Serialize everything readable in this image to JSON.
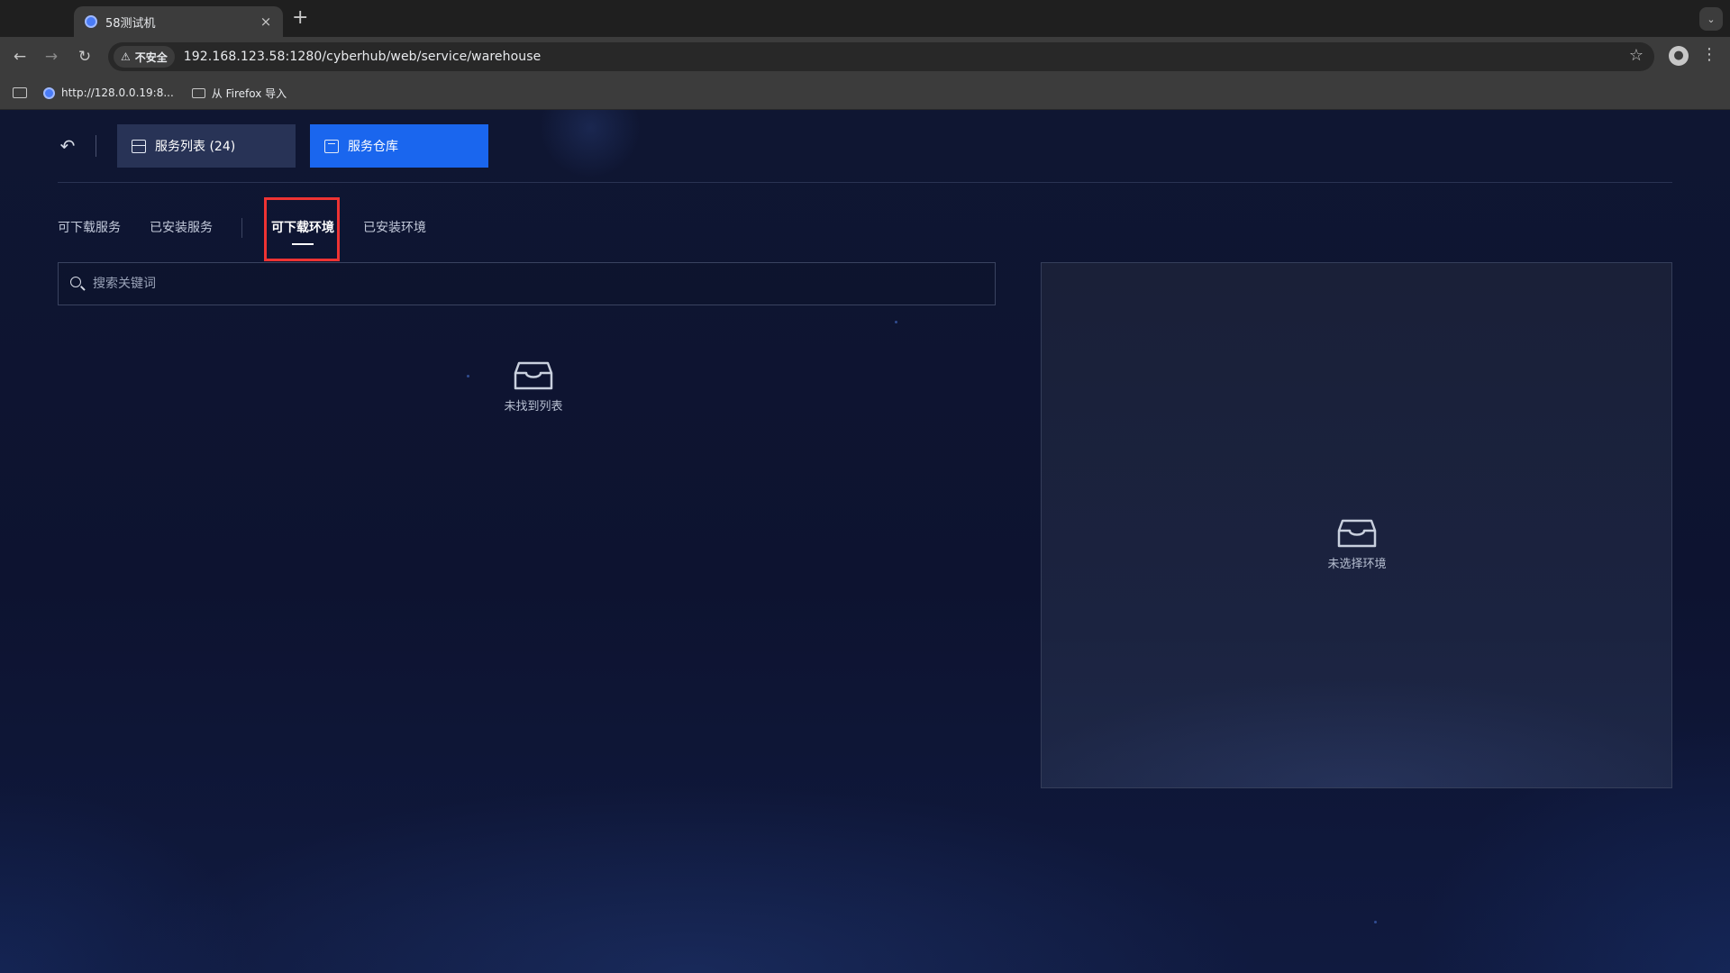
{
  "browser": {
    "tab_title": "58测试机",
    "tab_close": "×",
    "new_tab": "+",
    "security_label": "不安全",
    "url": "192.168.123.58:1280/cyberhub/web/service/warehouse",
    "bookmarks": [
      {
        "label": "http://128.0.0.19:8..."
      },
      {
        "label": "从 Firefox 导入"
      }
    ]
  },
  "app": {
    "top_buttons": {
      "service_list": "服务列表 (24)",
      "warehouse": "服务仓库"
    },
    "subtabs": [
      {
        "label": "可下载服务",
        "active": false
      },
      {
        "label": "已安装服务",
        "active": false
      },
      {
        "label": "可下载环境",
        "active": true
      },
      {
        "label": "已安装环境",
        "active": false
      }
    ],
    "search": {
      "placeholder": "搜索关键词",
      "value": ""
    },
    "list_empty_text": "未找到列表",
    "detail_empty_text": "未选择环境"
  },
  "colors": {
    "accent": "#1a66ee",
    "highlight": "#e33333",
    "background": "#0d1330"
  }
}
